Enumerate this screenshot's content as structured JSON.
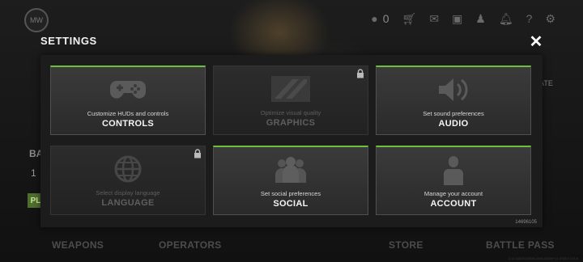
{
  "header": {
    "coin_count": "0",
    "icons": [
      "coin-icon",
      "store-icon",
      "mail-icon",
      "chat-icon",
      "friends-icon",
      "notification-icon",
      "help-icon",
      "gear-icon"
    ]
  },
  "background": {
    "side_letters": "BA",
    "side_number": "1",
    "side_button": "PL",
    "right_label": "ATE",
    "bottom_nav": [
      "WEAPONS",
      "OPERATORS",
      "STORE",
      "BATTLE PASS"
    ],
    "build_string": "2.11.14625.0/3346.1046.03829+11.3763.0.174.9"
  },
  "settings": {
    "title": "SETTINGS",
    "close_symbol": "✕",
    "build_id": "14696105",
    "tiles": [
      {
        "sub": "Customize HUDs and controls",
        "label": "CONTROLS",
        "locked": false,
        "icon": "gamepad-icon"
      },
      {
        "sub": "Optimize visual quality",
        "label": "GRAPHICS",
        "locked": true,
        "icon": "graphics-icon"
      },
      {
        "sub": "Set sound preferences",
        "label": "AUDIO",
        "locked": false,
        "icon": "speaker-icon"
      },
      {
        "sub": "Select display language",
        "label": "LANGUAGE",
        "locked": true,
        "icon": "globe-icon"
      },
      {
        "sub": "Set social preferences",
        "label": "SOCIAL",
        "locked": false,
        "icon": "people-icon"
      },
      {
        "sub": "Manage your account",
        "label": "ACCOUNT",
        "locked": false,
        "icon": "user-icon"
      }
    ]
  },
  "colors": {
    "accent": "#6fbf3e",
    "panel": "#1c1c1c",
    "tile": "#333333"
  }
}
